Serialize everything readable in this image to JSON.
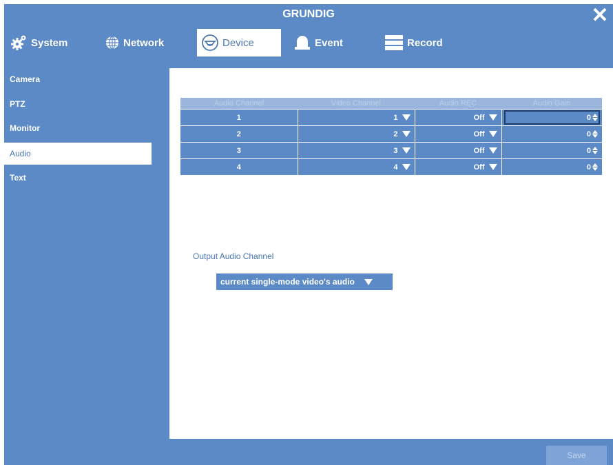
{
  "window": {
    "title": "GRUNDIG",
    "close_glyph": "✕"
  },
  "menu": [
    {
      "label": "System",
      "icon": "gear-icon"
    },
    {
      "label": "Network",
      "icon": "globe-icon"
    },
    {
      "label": "Device",
      "icon": "dome-camera-icon",
      "active": true
    },
    {
      "label": "Event",
      "icon": "bell-icon"
    },
    {
      "label": "Record",
      "icon": "list-icon"
    }
  ],
  "sidebar": [
    {
      "label": "Camera"
    },
    {
      "label": "PTZ"
    },
    {
      "label": "Monitor"
    },
    {
      "label": "Audio",
      "active": true
    },
    {
      "label": "Text"
    }
  ],
  "table": {
    "headers": [
      "Audio Channel",
      "Video Channel",
      "Audio REC",
      "Audio Gain"
    ],
    "rows": [
      {
        "audio_channel": "1",
        "video_channel": "1",
        "audio_rec": "Off",
        "audio_gain": "0"
      },
      {
        "audio_channel": "2",
        "video_channel": "2",
        "audio_rec": "Off",
        "audio_gain": "0"
      },
      {
        "audio_channel": "3",
        "video_channel": "3",
        "audio_rec": "Off",
        "audio_gain": "0"
      },
      {
        "audio_channel": "4",
        "video_channel": "4",
        "audio_rec": "Off",
        "audio_gain": "0"
      }
    ]
  },
  "output": {
    "label": "Output Audio Channel",
    "value": "current single-mode video's audio"
  },
  "footer": {
    "save_label": "Save"
  },
  "colors": {
    "background": "#5b8ac6",
    "panel": "#ffffff",
    "header_row": "#9ab6dc"
  }
}
